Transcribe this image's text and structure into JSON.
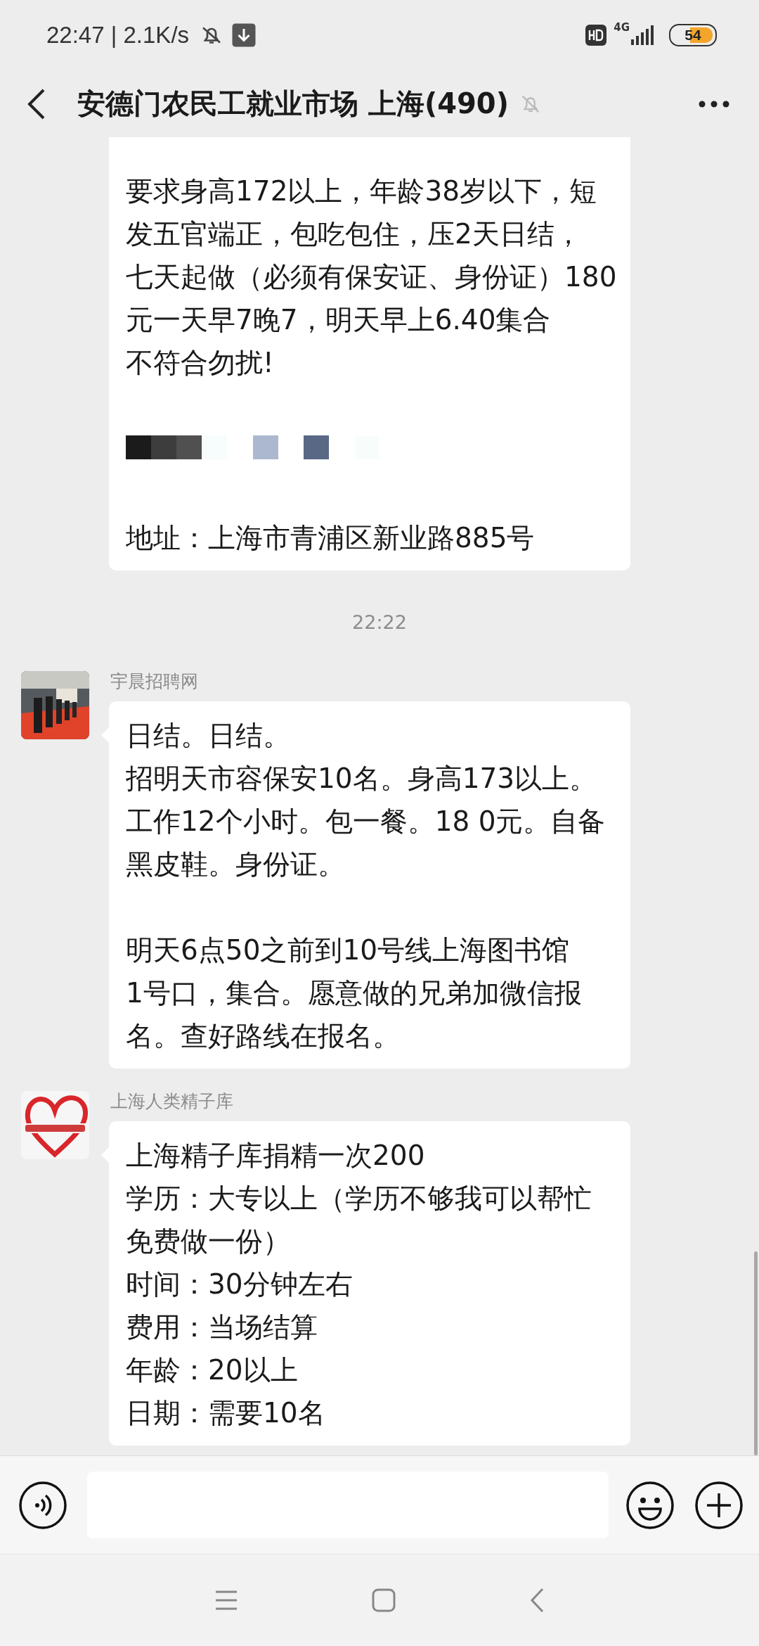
{
  "status_bar": {
    "time": "22:47 | 2.1K/s",
    "network": "4G",
    "battery": "54"
  },
  "header": {
    "title": "安德门农民工就业市场 上海(490)",
    "muted": true
  },
  "messages": [
    {
      "kind": "text",
      "paragraphs": [
        {
          "kind": "text",
          "lines": [
            "要求身高172以上，年龄38岁以下，短",
            "发五官端正，包吃包住，压2天日结，",
            "七天起做（必须有保安证、身份证）180",
            "元一天早7晚7，明天早上6.40集合",
            "不符合勿扰!"
          ]
        },
        {
          "kind": "redacted"
        },
        {
          "kind": "text",
          "lines": [
            "地址：上海市青浦区新业路885号"
          ]
        }
      ]
    },
    {
      "kind": "time",
      "text": "22:22"
    },
    {
      "kind": "text",
      "sender": "宇晨招聘网",
      "avatar": {
        "kind": "picture"
      },
      "paragraphs": [
        {
          "kind": "text",
          "lines": [
            "日结。日结。",
            "招明天市容保安10名。身高173以上。",
            "工作12个小时。包一餐。18 0元。自备",
            "黑皮鞋。身份证。"
          ]
        },
        {
          "kind": "blank"
        },
        {
          "kind": "text",
          "lines": [
            "明天6点50之前到10号线上海图书馆",
            "1号口，集合。愿意做的兄弟加微信报",
            "名。查好路线在报名。"
          ]
        }
      ]
    },
    {
      "kind": "text",
      "sender": "上海人类精子库",
      "avatar": {
        "kind": "picture"
      },
      "paragraphs": [
        {
          "kind": "text",
          "lines": [
            "上海精子库捐精一次200",
            "学历：大专以上（学历不够我可以帮忙",
            "免费做一份）",
            "时间：30分钟左右",
            "费用：当场结算",
            "年龄：20以上",
            "日期：需要10名"
          ]
        }
      ]
    }
  ]
}
